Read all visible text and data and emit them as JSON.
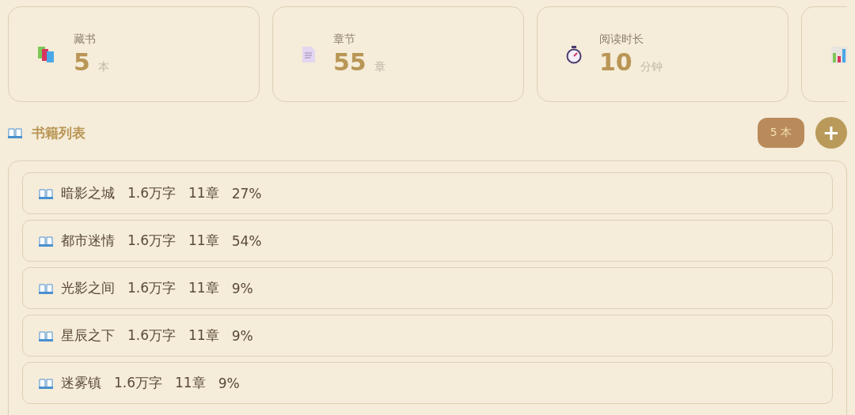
{
  "stats": [
    {
      "kind": "books",
      "label": "藏书",
      "value": "5",
      "unit": "本"
    },
    {
      "kind": "document",
      "label": "章节",
      "value": "55",
      "unit": "章"
    },
    {
      "kind": "stopwatch",
      "label": "阅读时长",
      "value": "10",
      "unit": "分钟"
    },
    {
      "kind": "chart"
    }
  ],
  "section": {
    "title": "书籍列表",
    "count_badge": "5 本",
    "add_button": "+"
  },
  "books": [
    {
      "title": "暗影之城",
      "words": "1.6万字",
      "chapters": "11章",
      "progress": "27%"
    },
    {
      "title": "都市迷情",
      "words": "1.6万字",
      "chapters": "11章",
      "progress": "54%"
    },
    {
      "title": "光影之间",
      "words": "1.6万字",
      "chapters": "11章",
      "progress": "9%"
    },
    {
      "title": "星辰之下",
      "words": "1.6万字",
      "chapters": "11章",
      "progress": "9%"
    },
    {
      "title": "迷雾镇",
      "words": "1.6万字",
      "chapters": "11章",
      "progress": "9%"
    }
  ]
}
